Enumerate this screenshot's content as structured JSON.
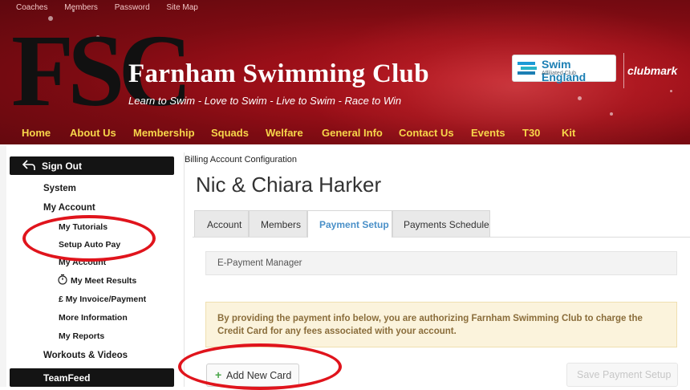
{
  "header": {
    "top_links": [
      "Coaches",
      "Members",
      "Password",
      "Site Map"
    ],
    "logo_letters": "FSC",
    "club_name": "Farnham Swimming Club",
    "tagline": "Learn to Swim - Love to Swim - Live to Swim - Race to Win",
    "partner_badge": {
      "title": "Swim England",
      "subtitle": "Affiliated Club"
    },
    "partner_logo_text": "clubmark",
    "nav": [
      "Home",
      "About Us",
      "Membership",
      "Squads",
      "Welfare",
      "General Info",
      "Contact Us",
      "Events",
      "T30",
      "Kit"
    ]
  },
  "sidebar": {
    "sign_out": "Sign Out",
    "system": "System",
    "my_account": "My Account",
    "sub_items": [
      "My Tutorials",
      "Setup Auto Pay",
      "My Account",
      "My Meet Results",
      "£ My Invoice/Payment",
      "More Information",
      "My Reports"
    ],
    "workouts": "Workouts & Videos",
    "teamfeed": "TeamFeed"
  },
  "main": {
    "breadcrumb": "Billing Account Configuration",
    "account_name": "Nic & Chiara Harker",
    "tabs": [
      "Account",
      "Members",
      "Payment Setup",
      "Payments Schedule"
    ],
    "active_tab": "Payment Setup",
    "section_title": "E-Payment Manager",
    "notice": "By providing the payment info below, you are authorizing Farnham Swimming Club to charge the Credit Card for any fees associated with your account.",
    "add_card": "Add New Card",
    "save_button": "Save Payment Setup"
  },
  "colors": {
    "banner_red": "#9a0f18",
    "nav_yellow": "#f7d64a",
    "active_tab_blue": "#4a90c8",
    "notice_bg": "#fbf3dc",
    "notice_text": "#8a6d3b",
    "annotation_red": "#e0141c"
  }
}
